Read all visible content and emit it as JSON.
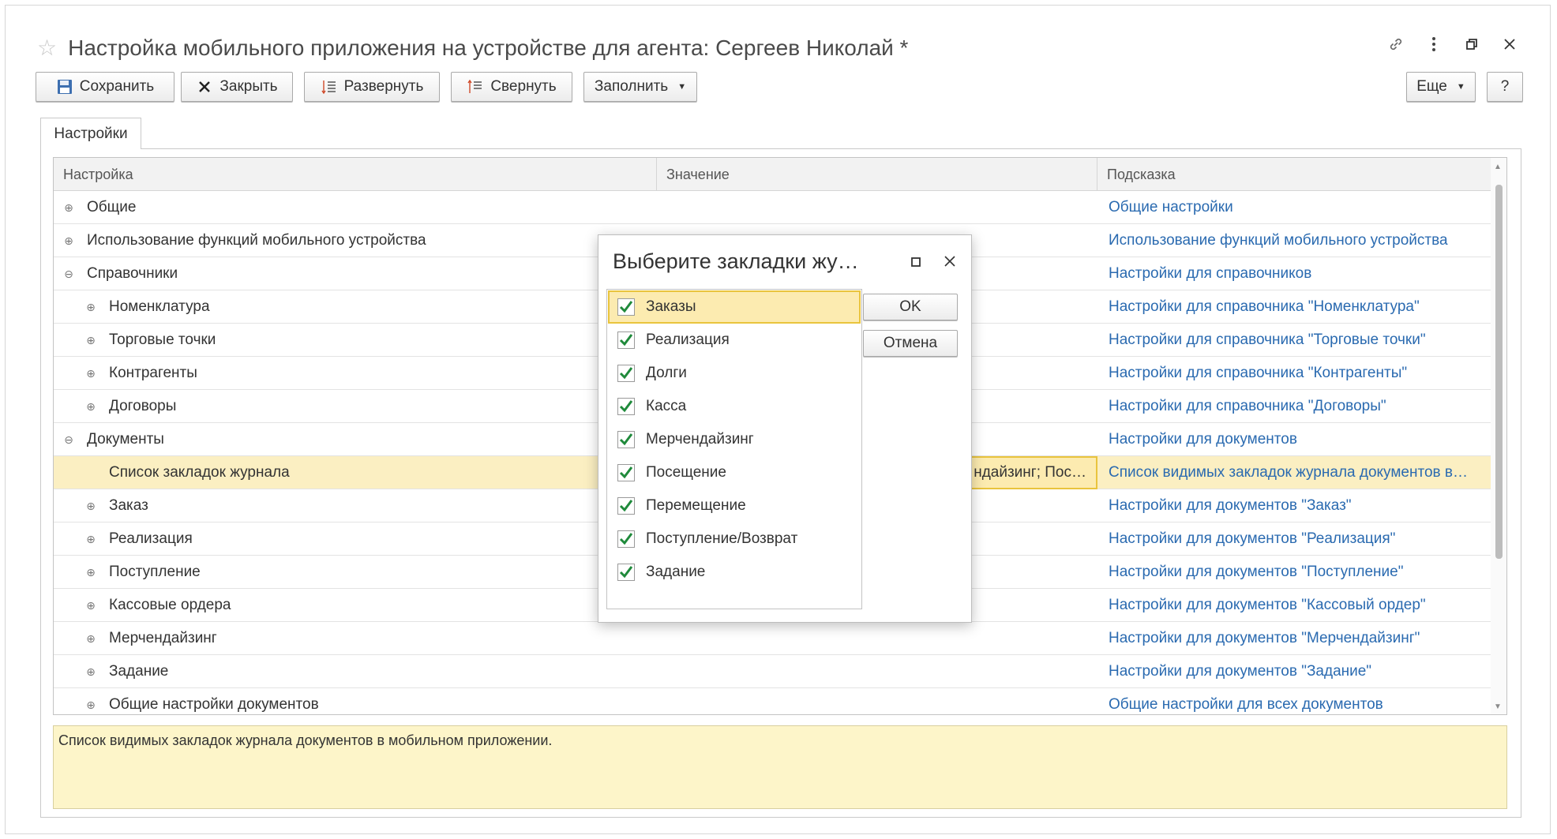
{
  "window": {
    "title": "Настройка мобильного приложения на устройстве для агента: Сергеев Николай *"
  },
  "toolbar": {
    "save_label": "Сохранить",
    "close_label": "Закрыть",
    "expand_label": "Развернуть",
    "collapse_label": "Свернуть",
    "fill_label": "Заполнить",
    "more_label": "Еще",
    "help_label": "?"
  },
  "tabs": [
    {
      "label": "Настройки"
    }
  ],
  "grid": {
    "columns": {
      "setting": "Настройка",
      "value": "Значение",
      "hint": "Подсказка"
    },
    "rows": [
      {
        "name": "Общие",
        "toggle": "⊕",
        "value": "",
        "hint": "Общие настройки"
      },
      {
        "name": "Использование функций мобильного устройства",
        "toggle": "⊕",
        "value": "",
        "hint": "Использование функций мобильного устройства"
      },
      {
        "name": "Справочники",
        "toggle": "⊖",
        "value": "",
        "hint": "Настройки для справочников"
      },
      {
        "name": "Номенклатура",
        "toggle": "⊕",
        "value": "",
        "hint": "Настройки для справочника \"Номенклатура\""
      },
      {
        "name": "Торговые точки",
        "toggle": "⊕",
        "value": "",
        "hint": "Настройки для справочника \"Торговые точки\""
      },
      {
        "name": "Контрагенты",
        "toggle": "⊕",
        "value": "",
        "hint": "Настройки для справочника \"Контрагенты\""
      },
      {
        "name": "Договоры",
        "toggle": "⊕",
        "value": "",
        "hint": "Настройки для справочника \"Договоры\""
      },
      {
        "name": "Документы",
        "toggle": "⊖",
        "value": "",
        "hint": "Настройки для документов"
      },
      {
        "name": "Список закладок журнала",
        "toggle": "",
        "value": "ндайзинг; Пос…",
        "hint": "Список видимых закладок журнала документов в…"
      },
      {
        "name": "Заказ",
        "toggle": "⊕",
        "value": "",
        "hint": "Настройки для документов \"Заказ\""
      },
      {
        "name": "Реализация",
        "toggle": "⊕",
        "value": "",
        "hint": "Настройки для документов \"Реализация\""
      },
      {
        "name": "Поступление",
        "toggle": "⊕",
        "value": "",
        "hint": "Настройки для документов \"Поступление\""
      },
      {
        "name": "Кассовые ордера",
        "toggle": "⊕",
        "value": "",
        "hint": "Настройки для документов \"Кассовый ордер\""
      },
      {
        "name": "Мерчендайзинг",
        "toggle": "⊕",
        "value": "",
        "hint": "Настройки для документов \"Мерчендайзинг\""
      },
      {
        "name": "Задание",
        "toggle": "⊕",
        "value": "",
        "hint": "Настройки для документов \"Задание\""
      },
      {
        "name": "Общие настройки документов",
        "toggle": "⊕",
        "value": "",
        "hint": "Общие настройки для всех документов"
      }
    ]
  },
  "hint_text": "Список видимых закладок журнала документов в мобильном приложении.",
  "dialog": {
    "title": "Выберите закладки жу…",
    "items": [
      {
        "label": "Заказы",
        "checked": true
      },
      {
        "label": "Реализация",
        "checked": true
      },
      {
        "label": "Долги",
        "checked": true
      },
      {
        "label": "Касса",
        "checked": true
      },
      {
        "label": "Мерчендайзинг",
        "checked": true
      },
      {
        "label": "Посещение",
        "checked": true
      },
      {
        "label": "Перемещение",
        "checked": true
      },
      {
        "label": "Поступление/Возврат",
        "checked": true
      },
      {
        "label": "Задание",
        "checked": true
      }
    ],
    "ok_label": "OK",
    "cancel_label": "Отмена"
  },
  "colors": {
    "link": "#2a6ab0",
    "selection": "#fbefc2",
    "selection_border": "#e9c43d",
    "check": "#1f8a3b"
  }
}
